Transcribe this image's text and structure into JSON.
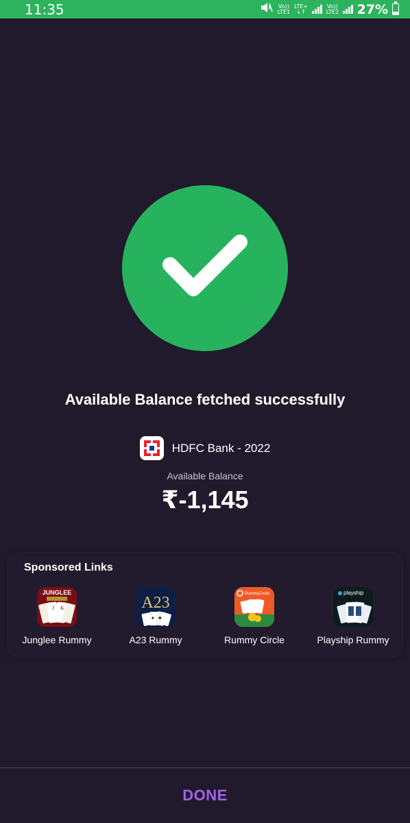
{
  "status_bar": {
    "time": "11:35",
    "sim1_top": "Vo))",
    "sim1_bottom": "LTE1",
    "lte_top": "LTE+",
    "lte_bottom": "↓↑",
    "sim2_top": "Vo))",
    "sim2_bottom": "LTE2",
    "battery_percent": "27%",
    "battery_level": 0.27,
    "icons": [
      "mute-icon",
      "signal-icon",
      "battery-icon"
    ]
  },
  "result": {
    "icon": "check-icon",
    "title": "Available Balance fetched successfully",
    "bank_name": "HDFC Bank - 2022",
    "balance_label": "Available Balance",
    "balance_value": "₹-1,145"
  },
  "sponsored": {
    "title": "Sponsored Links",
    "apps": [
      {
        "label": "Junglee Rummy",
        "icon": "junglee-rummy-icon",
        "brand_text": "JUNGLEE"
      },
      {
        "label": "A23 Rummy",
        "icon": "a23-rummy-icon",
        "brand_text": "A23"
      },
      {
        "label": "Rummy Circle",
        "icon": "rummy-circle-icon",
        "brand_text": "RummyCircle"
      },
      {
        "label": "Playship Rummy",
        "icon": "playship-rummy-icon",
        "brand_text": "playship"
      }
    ]
  },
  "footer": {
    "done_label": "DONE"
  },
  "colors": {
    "background": "#211a2c",
    "status_bar": "#2db35d",
    "success_green": "#27b35d",
    "accent_purple": "#a161ec"
  }
}
